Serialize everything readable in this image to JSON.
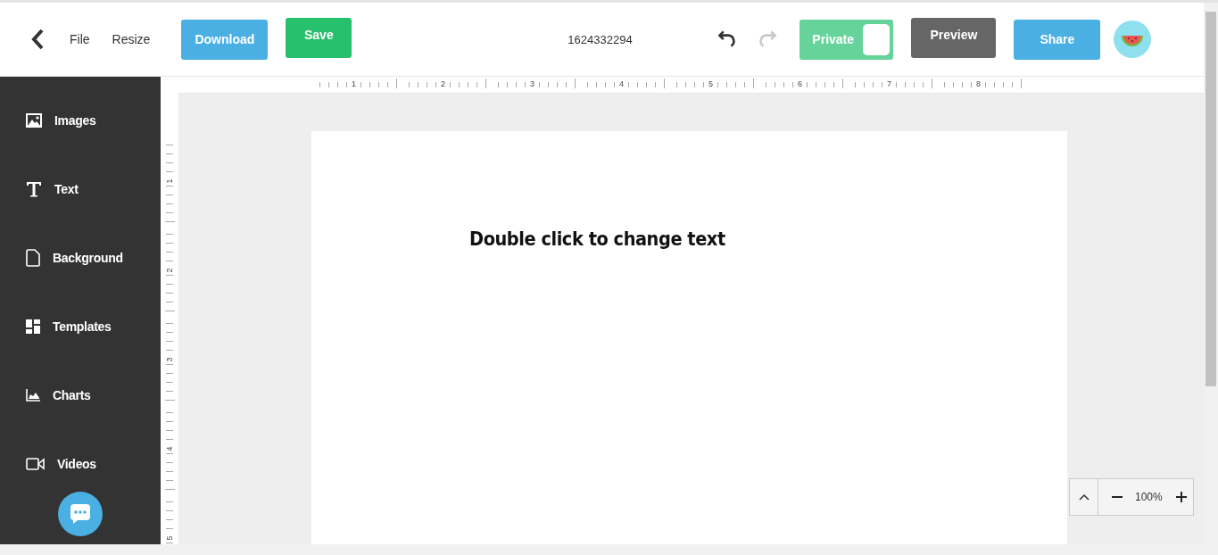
{
  "toolbar": {
    "menu": [
      "File",
      "Resize"
    ],
    "download": "Download",
    "save": "Save",
    "document_id": "1624332294",
    "undo": {
      "disabled": false
    },
    "redo": {
      "disabled": true
    },
    "private_toggle": {
      "label": "Private",
      "on": true
    },
    "preview": "Preview",
    "share": "Share"
  },
  "sidebar": {
    "items": [
      {
        "kind": "images",
        "label": "Images"
      },
      {
        "kind": "text",
        "label": "Text"
      },
      {
        "kind": "background",
        "label": "Background"
      },
      {
        "kind": "templates",
        "label": "Templates"
      },
      {
        "kind": "charts",
        "label": "Charts"
      },
      {
        "kind": "videos",
        "label": "Videos"
      }
    ]
  },
  "rulers": {
    "horizontal": [
      "1",
      "2",
      "3",
      "4",
      "5",
      "6",
      "7",
      "8"
    ],
    "vertical": [
      "1",
      "2",
      "3",
      "4",
      "5"
    ]
  },
  "canvas": {
    "text": "Double click to change text"
  },
  "zoom": {
    "level": "100%"
  }
}
